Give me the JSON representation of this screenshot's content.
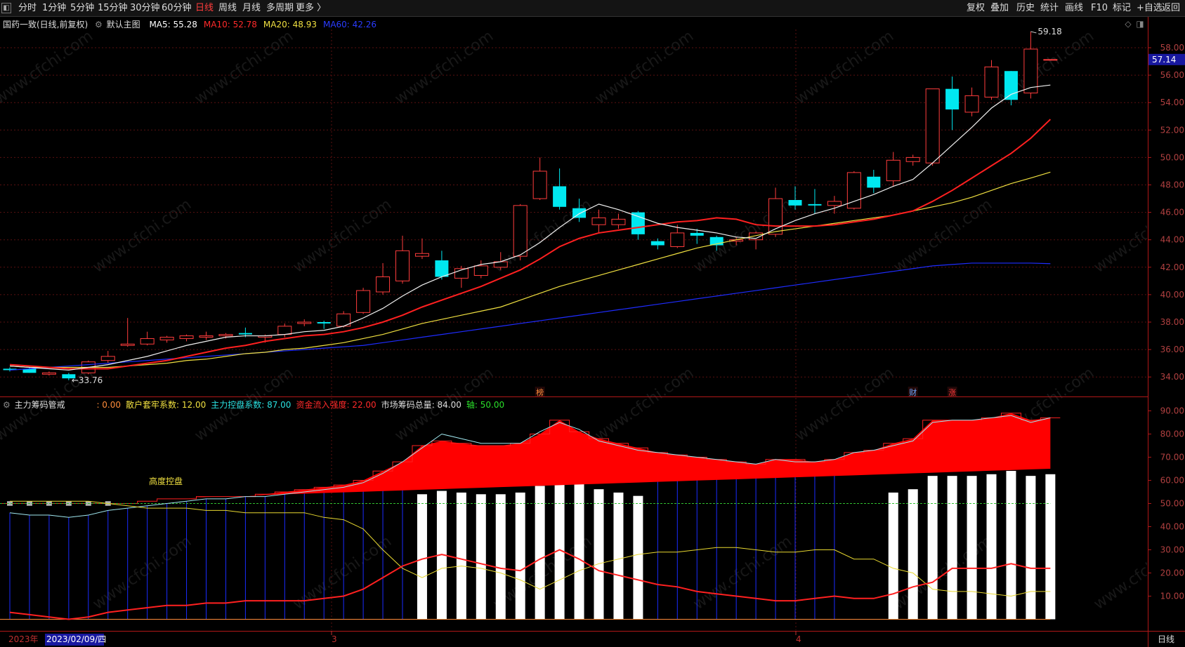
{
  "toolbar": {
    "left": [
      {
        "label": "分时",
        "active": false
      },
      {
        "label": "1分钟",
        "active": false
      },
      {
        "label": "5分钟",
        "active": false
      },
      {
        "label": "15分钟",
        "active": false
      },
      {
        "label": "30分钟",
        "active": false
      },
      {
        "label": "60分钟",
        "active": false
      },
      {
        "label": "日线",
        "active": true
      },
      {
        "label": "周线",
        "active": false
      },
      {
        "label": "月线",
        "active": false
      },
      {
        "label": "多周期",
        "active": false
      },
      {
        "label": "更多 〉",
        "active": false
      }
    ],
    "right": [
      "复权",
      "叠加",
      "历史",
      "统计",
      "画线",
      "F10",
      "标记",
      "+自选",
      "返回"
    ]
  },
  "main_pane": {
    "title": "国药一致(日线,前复权)",
    "indicator": "默认主图",
    "ma": [
      {
        "label": "MA5: 55.28",
        "color": "#ffffff"
      },
      {
        "label": "MA10: 52.78",
        "color": "#ff2a2a"
      },
      {
        "label": "MA20: 48.93",
        "color": "#f0e040"
      },
      {
        "label": "MA60: 42.26",
        "color": "#2a3cff"
      }
    ],
    "y_ticks": [
      "58.00",
      "56.00",
      "54.00",
      "52.00",
      "50.00",
      "48.00",
      "46.00",
      "44.00",
      "42.00",
      "40.00",
      "38.00",
      "36.00",
      "34.00"
    ],
    "current_price": "57.14",
    "high_label": "59.18",
    "low_label": "←33.76",
    "markers": [
      {
        "label": "榜",
        "color": "#ff8c3a",
        "index": 27
      },
      {
        "label": "财",
        "color": "#6ea8ff",
        "index": 46
      },
      {
        "label": "涨",
        "color": "#ff3a3a",
        "index": 48
      }
    ]
  },
  "sub_pane": {
    "title": "主力筹码管戒",
    "items": [
      {
        "label": ": 0.00",
        "color": "#ff8c3a"
      },
      {
        "label": "散户套牢系数: 12.00",
        "color": "#f0e040"
      },
      {
        "label": "主力控盘系数: 87.00",
        "color": "#2ae0e0"
      },
      {
        "label": "资金流入强度: 22.00",
        "color": "#ff2a2a"
      },
      {
        "label": "市场筹码总量: 84.00",
        "color": "#dddddd"
      },
      {
        "label": "轴: 50.00",
        "color": "#2ae02a"
      }
    ],
    "y_ticks": [
      "90.00",
      "80.00",
      "70.00",
      "60.00",
      "50.00",
      "40.00",
      "30.00",
      "20.00",
      "10.00"
    ],
    "annotation": "高度控盘"
  },
  "x_axis": {
    "year_label": "2023年",
    "cursor_date": "2023/02/09/四",
    "month_labels": [
      "3",
      "4"
    ],
    "period": "日线"
  },
  "watermark": "www.cfchi.com",
  "chart_data": {
    "type": "candlestick",
    "count": 54,
    "candles": [
      [
        34.6,
        34.5,
        34.7,
        34.4
      ],
      [
        34.6,
        34.3,
        34.7,
        34.3
      ],
      [
        34.2,
        34.3,
        34.4,
        34.1
      ],
      [
        34.2,
        33.9,
        34.3,
        33.76
      ],
      [
        34.3,
        35.1,
        35.2,
        34.2
      ],
      [
        35.2,
        35.5,
        35.9,
        35.0
      ],
      [
        36.3,
        36.4,
        38.3,
        36.2
      ],
      [
        36.4,
        36.8,
        37.3,
        36.3
      ],
      [
        36.7,
        36.9,
        37.0,
        36.5
      ],
      [
        36.8,
        37.0,
        37.1,
        36.6
      ],
      [
        36.9,
        37.0,
        37.3,
        36.7
      ],
      [
        37.0,
        37.1,
        37.2,
        36.8
      ],
      [
        37.2,
        37.1,
        37.6,
        36.9
      ],
      [
        36.9,
        37.0,
        37.1,
        36.5
      ],
      [
        37.1,
        37.7,
        37.9,
        36.9
      ],
      [
        37.9,
        38.0,
        38.2,
        37.7
      ],
      [
        38.0,
        37.9,
        38.1,
        37.5
      ],
      [
        37.7,
        38.6,
        38.8,
        37.6
      ],
      [
        38.7,
        40.3,
        40.5,
        38.6
      ],
      [
        40.2,
        41.3,
        42.3,
        40.0
      ],
      [
        41.0,
        43.2,
        44.3,
        40.8
      ],
      [
        42.8,
        43.0,
        44.1,
        42.6
      ],
      [
        42.5,
        41.3,
        43.2,
        41.1
      ],
      [
        41.2,
        41.9,
        42.1,
        40.5
      ],
      [
        41.4,
        42.1,
        42.5,
        41.2
      ],
      [
        42.0,
        42.4,
        43.1,
        41.8
      ],
      [
        42.8,
        46.5,
        46.6,
        42.5
      ],
      [
        47.0,
        49.0,
        50.0,
        46.9
      ],
      [
        47.9,
        46.4,
        49.2,
        46.2
      ],
      [
        46.3,
        45.6,
        47.0,
        45.3
      ],
      [
        45.1,
        45.6,
        46.2,
        44.5
      ],
      [
        45.1,
        45.5,
        45.9,
        44.8
      ],
      [
        46.0,
        44.4,
        46.1,
        44.0
      ],
      [
        43.9,
        43.6,
        44.1,
        43.3
      ],
      [
        43.5,
        44.5,
        45.1,
        43.4
      ],
      [
        44.5,
        44.3,
        44.8,
        43.7
      ],
      [
        44.2,
        43.6,
        44.3,
        43.2
      ],
      [
        43.9,
        44.0,
        44.2,
        43.6
      ],
      [
        44.0,
        44.5,
        44.6,
        43.3
      ],
      [
        44.4,
        47.0,
        47.8,
        44.2
      ],
      [
        46.9,
        46.5,
        47.9,
        46.2
      ],
      [
        46.6,
        46.5,
        47.7,
        45.9
      ],
      [
        46.5,
        46.8,
        47.2,
        45.9
      ],
      [
        46.3,
        48.9,
        49.0,
        46.2
      ],
      [
        48.6,
        47.8,
        49.1,
        47.4
      ],
      [
        48.3,
        49.8,
        50.4,
        47.9
      ],
      [
        49.7,
        50.0,
        50.2,
        49.4
      ],
      [
        49.6,
        55.0,
        55.0,
        49.4
      ],
      [
        55.0,
        53.5,
        55.9,
        52.0
      ],
      [
        53.3,
        54.5,
        55.1,
        53.0
      ],
      [
        54.4,
        56.6,
        57.1,
        54.2
      ],
      [
        56.3,
        54.2,
        56.3,
        53.8
      ],
      [
        54.7,
        57.9,
        59.18,
        54.3
      ],
      [
        57.1,
        57.14,
        57.14,
        57.14
      ]
    ],
    "ma5": [
      34.8,
      34.7,
      34.6,
      34.5,
      34.7,
      34.9,
      35.2,
      35.5,
      35.9,
      36.3,
      36.6,
      36.9,
      37.0,
      37.0,
      37.1,
      37.3,
      37.4,
      37.7,
      38.3,
      39.0,
      39.9,
      40.7,
      41.3,
      41.8,
      42.2,
      42.4,
      42.9,
      43.8,
      44.9,
      45.9,
      46.6,
      46.2,
      45.7,
      45.2,
      44.9,
      44.7,
      44.5,
      44.2,
      44.1,
      44.8,
      45.4,
      45.9,
      46.3,
      46.8,
      47.3,
      47.9,
      48.4,
      49.6,
      50.9,
      52.2,
      53.6,
      54.6,
      55.1,
      55.28
    ],
    "ma10": [
      34.9,
      34.8,
      34.7,
      34.6,
      34.6,
      34.6,
      34.8,
      35.0,
      35.2,
      35.5,
      35.8,
      36.1,
      36.3,
      36.6,
      36.8,
      37.0,
      37.1,
      37.3,
      37.6,
      38.0,
      38.5,
      39.1,
      39.6,
      40.1,
      40.6,
      41.2,
      41.8,
      42.6,
      43.5,
      44.1,
      44.5,
      44.7,
      44.9,
      45.1,
      45.3,
      45.4,
      45.6,
      45.5,
      45.1,
      45.0,
      45.0,
      45.0,
      45.1,
      45.3,
      45.5,
      45.8,
      46.1,
      46.8,
      47.6,
      48.5,
      49.4,
      50.3,
      51.4,
      52.78
    ],
    "ma20": [
      34.8,
      34.7,
      34.7,
      34.7,
      34.7,
      34.7,
      34.8,
      34.9,
      35.0,
      35.2,
      35.3,
      35.5,
      35.7,
      35.8,
      36.0,
      36.1,
      36.3,
      36.5,
      36.8,
      37.1,
      37.5,
      37.9,
      38.2,
      38.5,
      38.8,
      39.1,
      39.6,
      40.1,
      40.6,
      41.0,
      41.4,
      41.8,
      42.2,
      42.6,
      43.0,
      43.4,
      43.7,
      44.0,
      44.3,
      44.6,
      44.8,
      45.0,
      45.2,
      45.4,
      45.6,
      45.8,
      46.1,
      46.4,
      46.7,
      47.1,
      47.6,
      48.1,
      48.5,
      48.93
    ],
    "ma60": [
      34.5,
      34.6,
      34.7,
      34.8,
      34.9,
      35.0,
      35.1,
      35.2,
      35.3,
      35.4,
      35.5,
      35.6,
      35.7,
      35.8,
      35.9,
      36.0,
      36.1,
      36.2,
      36.3,
      36.5,
      36.7,
      36.9,
      37.1,
      37.3,
      37.5,
      37.7,
      37.9,
      38.1,
      38.3,
      38.5,
      38.7,
      38.9,
      39.1,
      39.3,
      39.5,
      39.7,
      39.9,
      40.1,
      40.3,
      40.5,
      40.7,
      40.9,
      41.1,
      41.3,
      41.5,
      41.7,
      41.9,
      42.1,
      42.2,
      42.3,
      42.3,
      42.3,
      42.3,
      42.26
    ],
    "sub": {
      "market_total": [
        49,
        49,
        49,
        49,
        49,
        49,
        50,
        51,
        52,
        52,
        53,
        53,
        53,
        54,
        55,
        56,
        57,
        58,
        60,
        64,
        68,
        75,
        77,
        76,
        75,
        75,
        76,
        80,
        86,
        81,
        78,
        76,
        74,
        72,
        71,
        70,
        69,
        68,
        67,
        69,
        69,
        68,
        69,
        72,
        73,
        76,
        78,
        86,
        86,
        86,
        87,
        89,
        86,
        87
      ],
      "main_ctrl": [
        46,
        45,
        45,
        44,
        45,
        47,
        48,
        49,
        50,
        51,
        52,
        52,
        53,
        53,
        54,
        55,
        56,
        57,
        59,
        63,
        68,
        74,
        80,
        78,
        76,
        76,
        76,
        81,
        85,
        82,
        77,
        75,
        73,
        72,
        71,
        70,
        69,
        68,
        67,
        69,
        68,
        68,
        69,
        72,
        73,
        75,
        77,
        85,
        86,
        86,
        87,
        88,
        85,
        87
      ],
      "retail": [
        51,
        51,
        51,
        51,
        51,
        50,
        49,
        48,
        48,
        48,
        47,
        47,
        46,
        46,
        46,
        46,
        44,
        43,
        39,
        30,
        22,
        18,
        22,
        23,
        22,
        20,
        17,
        13,
        17,
        21,
        24,
        26,
        28,
        29,
        29,
        30,
        31,
        31,
        30,
        29,
        29,
        30,
        30,
        26,
        26,
        22,
        20,
        13,
        12,
        12,
        11,
        10,
        12,
        12
      ],
      "inflow": [
        3,
        2,
        1,
        0,
        1,
        3,
        4,
        5,
        6,
        6,
        7,
        7,
        8,
        8,
        8,
        8,
        9,
        10,
        13,
        18,
        23,
        26,
        28,
        26,
        24,
        22,
        21,
        26,
        30,
        26,
        21,
        19,
        17,
        15,
        14,
        12,
        11,
        10,
        9,
        8,
        8,
        9,
        10,
        9,
        9,
        11,
        14,
        16,
        22,
        22,
        22,
        24,
        22,
        22
      ],
      "zero_line": 0,
      "axis": 50
    }
  }
}
